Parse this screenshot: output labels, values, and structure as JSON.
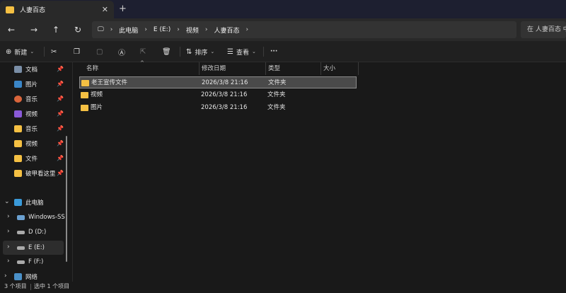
{
  "tab": {
    "title": "人妻百态",
    "close": "✕",
    "new": "+"
  },
  "nav": {
    "back": "←",
    "forward": "→",
    "up": "↑",
    "refresh": "↻"
  },
  "address": {
    "computer_icon": "🖵",
    "crumbs": [
      "此电脑",
      "E (E:)",
      "视频",
      "人妻百态"
    ],
    "separator": "›"
  },
  "search": {
    "placeholder": "在 人妻百态 中搜索"
  },
  "commands": {
    "new_label": "新建",
    "sort_label": "排序",
    "view_label": "查看",
    "more": "···"
  },
  "sidebar": {
    "quick": [
      {
        "label": "文档",
        "icon": "document-icon",
        "color": "#7a8ea6"
      },
      {
        "label": "图片",
        "icon": "pictures-icon",
        "color": "#3a86c8"
      },
      {
        "label": "音乐",
        "icon": "music-icon",
        "color": "#d9653b"
      },
      {
        "label": "视频",
        "icon": "video-icon",
        "color": "#8a5ad8"
      },
      {
        "label": "音乐",
        "icon": "folder-icon",
        "color": "#f5c043"
      },
      {
        "label": "视频",
        "icon": "folder-icon",
        "color": "#f5c043"
      },
      {
        "label": "文件",
        "icon": "folder-icon",
        "color": "#f5c043"
      },
      {
        "label": "破甲看这里",
        "icon": "folder-icon",
        "color": "#f5c043"
      }
    ],
    "this_pc": "此电脑",
    "drives": [
      "Windows-SSD",
      "D (D:)",
      "E (E:)",
      "F (F:)"
    ],
    "network": "网络"
  },
  "columns": {
    "name": "名称",
    "modified": "修改日期",
    "type": "类型",
    "size": "大小"
  },
  "files": [
    {
      "name": "老王宣传文件",
      "modified": "2026/3/8 21:16",
      "type": "文件夹",
      "size": ""
    },
    {
      "name": "视频",
      "modified": "2026/3/8 21:16",
      "type": "文件夹",
      "size": ""
    },
    {
      "name": "图片",
      "modified": "2026/3/8 21:16",
      "type": "文件夹",
      "size": ""
    }
  ],
  "status": {
    "count": "3 个项目",
    "selected": "选中 1 个项目"
  },
  "colors": {
    "accent": "#f5c043",
    "tabbar": "#1d1f30",
    "background": "#191919"
  }
}
